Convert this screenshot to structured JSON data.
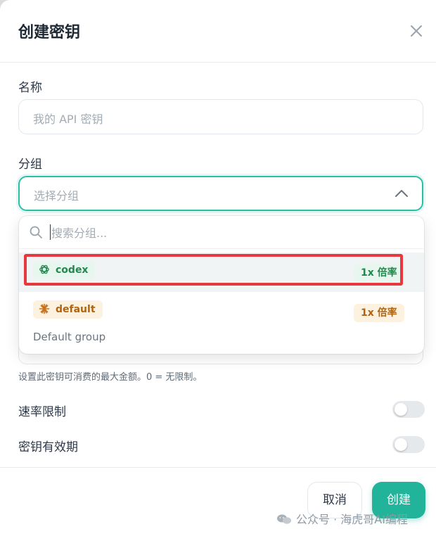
{
  "dialog": {
    "title": "创建密钥",
    "close_icon": "close-icon"
  },
  "name_field": {
    "label": "名称",
    "placeholder": "我的 API 密钥"
  },
  "group_field": {
    "label": "分组",
    "placeholder": "选择分组",
    "expanded": true,
    "accent_color": "#2dbfa6"
  },
  "dropdown": {
    "search_placeholder": "搜索分组...",
    "options": [
      {
        "name": "codex",
        "rate": "1x 倍率",
        "description": "",
        "icon": "openai-icon",
        "color": "#1f8a4c",
        "selected": true,
        "highlighted": true
      },
      {
        "name": "default",
        "rate": "1x 倍率",
        "description": "Default group",
        "icon": "sparkle-icon",
        "color": "#b0640f",
        "selected": false,
        "highlighted": false
      }
    ]
  },
  "quota": {
    "hint": "设置此密钥可消费的最大金额。0 = 无限制。"
  },
  "rate_limit": {
    "label": "速率限制",
    "enabled": false
  },
  "expiry": {
    "label": "密钥有效期",
    "enabled": false
  },
  "footer": {
    "cancel_label": "取消",
    "create_label": "创建",
    "create_color": "#21b49a"
  },
  "watermark": {
    "text": "公众号 · 海虎哥AI编程",
    "icon": "wechat-icon"
  }
}
